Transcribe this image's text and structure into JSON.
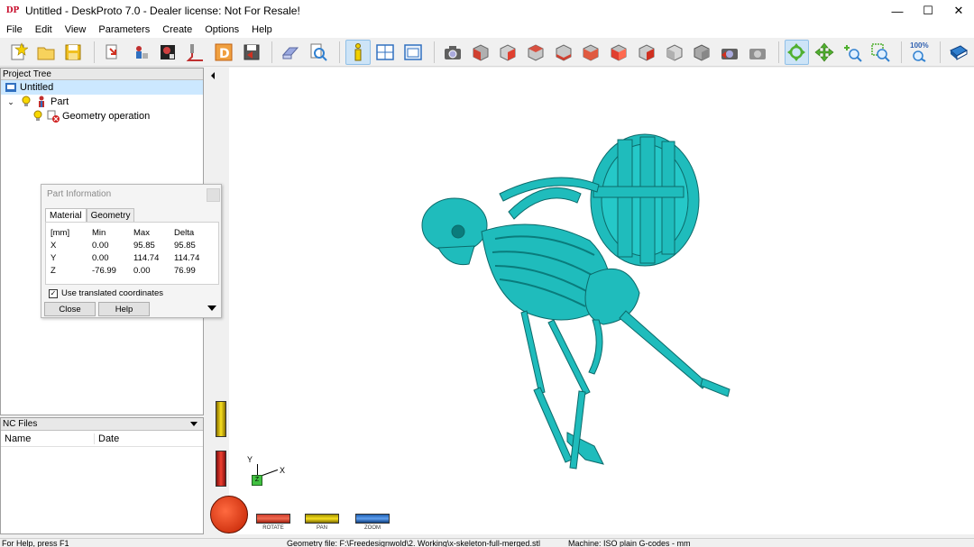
{
  "window": {
    "title": "Untitled - DeskProto 7.0 - Dealer license: Not For Resale!",
    "app_icon_text": "DP",
    "minimize": "—",
    "maximize": "☐",
    "close": "✕"
  },
  "menu": [
    "File",
    "Edit",
    "View",
    "Parameters",
    "Create",
    "Options",
    "Help"
  ],
  "toolbar": {
    "zoom_label": "100%"
  },
  "project_tree": {
    "header": "Project Tree",
    "items": [
      {
        "label": "Untitled"
      },
      {
        "label": "Part"
      },
      {
        "label": "Geometry operation"
      }
    ]
  },
  "nc_files": {
    "header": "NC Files",
    "columns": [
      "Name",
      "Date"
    ]
  },
  "part_info": {
    "title": "Part Information",
    "tabs": [
      "Material",
      "Geometry"
    ],
    "table": {
      "header": [
        "[mm]",
        "Min",
        "Max",
        "Delta"
      ],
      "rows": [
        [
          "X",
          "0.00",
          "95.85",
          "95.85"
        ],
        [
          "Y",
          "0.00",
          "114.74",
          "114.74"
        ],
        [
          "Z",
          "-76.99",
          "0.00",
          "76.99"
        ]
      ]
    },
    "checkbox_label": "Use translated coordinates",
    "checkbox_checked": true,
    "close_button": "Close",
    "help_button": "Help"
  },
  "viewport": {
    "model_color": "#1fbcbc",
    "axis_y": "Y",
    "axis_x": "X",
    "axis_z": "Z"
  },
  "view_tools": {
    "rotate": "ROTATE",
    "pan": "PAN",
    "zoom": "ZOOM"
  },
  "status": {
    "help": "For Help, press F1",
    "geometry": "Geometry file: F:\\Freedesignwold\\2. Working\\x-skeleton-full-merged.stl",
    "machine": "Machine: ISO plain G-codes - mm"
  }
}
